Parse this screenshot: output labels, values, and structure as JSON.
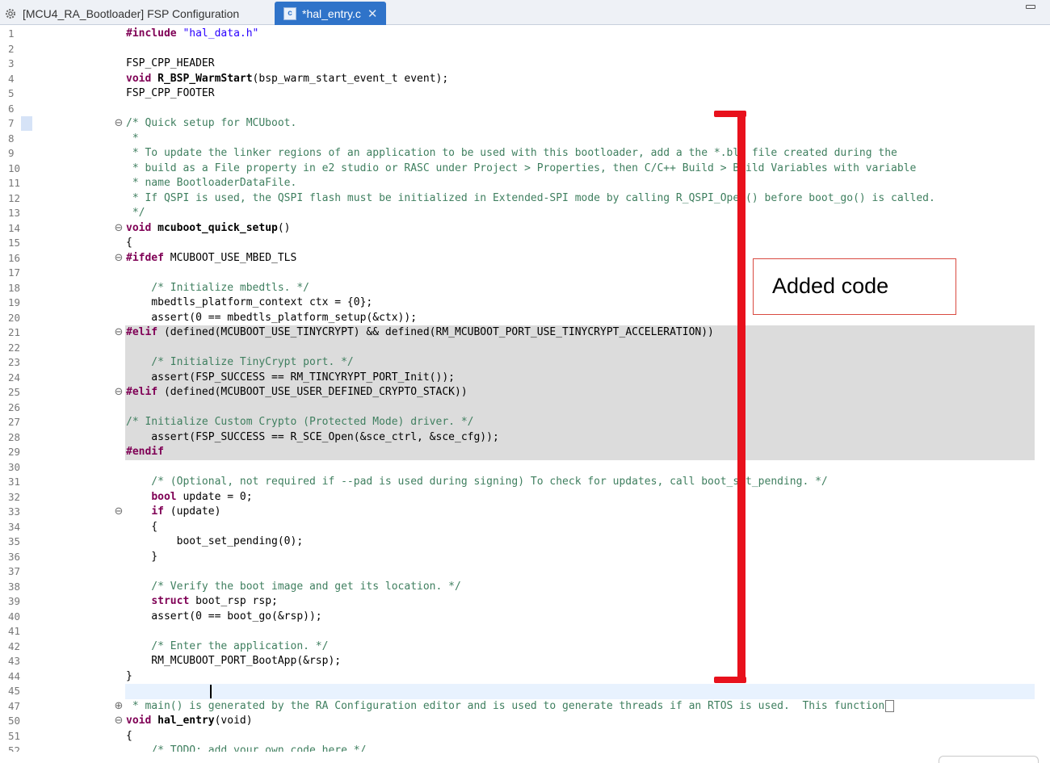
{
  "tabs": [
    {
      "label": "[MCU4_RA_Bootloader] FSP Configuration",
      "icon": "gear-icon",
      "active": false
    },
    {
      "label": "*hal_entry.c",
      "icon": "c-file-icon",
      "active": true,
      "close": "✕"
    }
  ],
  "annotation": {
    "callout_text": "Added code",
    "bracket_color": "#e8111c"
  },
  "colors": {
    "keyword": "#7f0055",
    "comment": "#3f7f5f",
    "string": "#2a00ff",
    "active_tab": "#2f73c9",
    "inactive_block": "#dcdcdc"
  },
  "lines": [
    {
      "n": "1",
      "t": "#include \"hal_data.h\""
    },
    {
      "n": "2",
      "t": ""
    },
    {
      "n": "3",
      "t": "FSP_CPP_HEADER"
    },
    {
      "n": "4",
      "t": "void R_BSP_WarmStart(bsp_warm_start_event_t event);"
    },
    {
      "n": "5",
      "t": "FSP_CPP_FOOTER"
    },
    {
      "n": "6",
      "t": ""
    },
    {
      "n": "7",
      "t": "/* Quick setup for MCUboot."
    },
    {
      "n": "8",
      "t": " *"
    },
    {
      "n": "9",
      "t": " * To update the linker regions of an application to be used with this bootloader, add a the *.bld file created during the"
    },
    {
      "n": "10",
      "t": " * build as a File property in e2 studio or RASC under Project > Properties, then C/C++ Build > Build Variables with variable"
    },
    {
      "n": "11",
      "t": " * name BootloaderDataFile."
    },
    {
      "n": "12",
      "t": " * If QSPI is used, the QSPI flash must be initialized in Extended-SPI mode by calling R_QSPI_Open() before boot_go() is called."
    },
    {
      "n": "13",
      "t": " */"
    },
    {
      "n": "14",
      "t": "void mcuboot_quick_setup()"
    },
    {
      "n": "15",
      "t": "{"
    },
    {
      "n": "16",
      "t": "#ifdef MCUBOOT_USE_MBED_TLS"
    },
    {
      "n": "17",
      "t": ""
    },
    {
      "n": "18",
      "t": "    /* Initialize mbedtls. */"
    },
    {
      "n": "19",
      "t": "    mbedtls_platform_context ctx = {0};"
    },
    {
      "n": "20",
      "t": "    assert(0 == mbedtls_platform_setup(&ctx));"
    },
    {
      "n": "21",
      "t": "#elif (defined(MCUBOOT_USE_TINYCRYPT) && defined(RM_MCUBOOT_PORT_USE_TINYCRYPT_ACCELERATION))"
    },
    {
      "n": "22",
      "t": ""
    },
    {
      "n": "23",
      "t": "    /* Initialize TinyCrypt port. */"
    },
    {
      "n": "24",
      "t": "    assert(FSP_SUCCESS == RM_TINCYRYPT_PORT_Init());"
    },
    {
      "n": "25",
      "t": "#elif (defined(MCUBOOT_USE_USER_DEFINED_CRYPTO_STACK))"
    },
    {
      "n": "26",
      "t": ""
    },
    {
      "n": "27",
      "t": "/* Initialize Custom Crypto (Protected Mode) driver. */"
    },
    {
      "n": "28",
      "t": "    assert(FSP_SUCCESS == R_SCE_Open(&sce_ctrl, &sce_cfg));"
    },
    {
      "n": "29",
      "t": "#endif"
    },
    {
      "n": "30",
      "t": ""
    },
    {
      "n": "31",
      "t": "    /* (Optional, not required if --pad is used during signing) To check for updates, call boot_set_pending. */"
    },
    {
      "n": "32",
      "t": "    bool update = 0;"
    },
    {
      "n": "33",
      "t": "    if (update)"
    },
    {
      "n": "34",
      "t": "    {"
    },
    {
      "n": "35",
      "t": "        boot_set_pending(0);"
    },
    {
      "n": "36",
      "t": "    }"
    },
    {
      "n": "37",
      "t": ""
    },
    {
      "n": "38",
      "t": "    /* Verify the boot image and get its location. */"
    },
    {
      "n": "39",
      "t": "    struct boot_rsp rsp;"
    },
    {
      "n": "40",
      "t": "    assert(0 == boot_go(&rsp));"
    },
    {
      "n": "41",
      "t": ""
    },
    {
      "n": "42",
      "t": "    /* Enter the application. */"
    },
    {
      "n": "43",
      "t": "    RM_MCUBOOT_PORT_BootApp(&rsp);"
    },
    {
      "n": "44",
      "t": "}"
    },
    {
      "n": "45",
      "t": ""
    },
    {
      "n": "47",
      "t": " * main() is generated by the RA Configuration editor and is used to generate threads if an RTOS is used.  This function"
    },
    {
      "n": "50",
      "t": "void hal_entry(void)"
    },
    {
      "n": "51",
      "t": "{"
    },
    {
      "n": "52",
      "t": "    /* TODO: add your own code here */"
    }
  ]
}
